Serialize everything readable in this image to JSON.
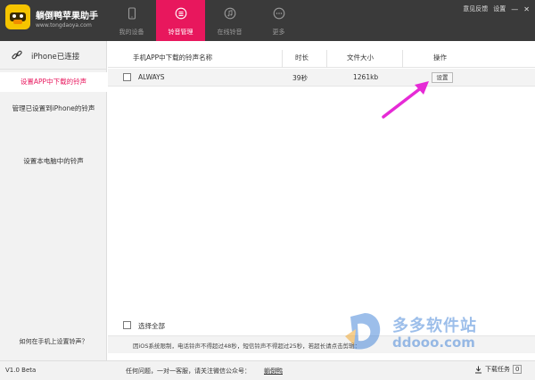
{
  "app": {
    "title": "躺倒鸭苹果助手",
    "url": "www.tongdaoya.com"
  },
  "top_links": {
    "feedback": "意见反馈",
    "settings": "设置"
  },
  "nav": {
    "tabs": [
      {
        "label": "我的设备",
        "icon": "phone-icon",
        "active": false
      },
      {
        "label": "铃音管理",
        "icon": "ringtone-icon",
        "active": true
      },
      {
        "label": "在线铃音",
        "icon": "music-note-icon",
        "active": false
      },
      {
        "label": "更多",
        "icon": "more-icon",
        "active": false
      }
    ]
  },
  "sidebar": {
    "connection": {
      "label": "iPhone已连接",
      "icon": "link-icon"
    },
    "items": [
      {
        "label": "设置APP中下载的铃声",
        "active": true
      },
      {
        "label": "管理已设置到iPhone的铃声",
        "active": false
      },
      {
        "label": "设置本电脑中的铃声",
        "active": false
      }
    ],
    "help": "如何在手机上设置铃声？"
  },
  "table": {
    "headers": [
      "手机APP中下载的铃声名称",
      "时长",
      "文件大小",
      "操作"
    ],
    "rows": [
      {
        "name": "ALWAYS",
        "duration": "39秒",
        "size": "1261kb",
        "action": "设置"
      }
    ],
    "select_all": "选择全部",
    "note": "因iOS系统限制，电话铃声不得超过48秒，短信铃声不得超过25秒，若超长请点击剪辑："
  },
  "status": {
    "version": "V1.0 Beta",
    "message": "任何问题，一对一客服，请关注微信公众号：",
    "link": "躺倒鸭",
    "download": "下载任务",
    "download_count": "0"
  },
  "watermark": {
    "line1": "多多软件站",
    "line2": "ddooo.com"
  },
  "colors": {
    "accent": "#e8175d",
    "header_bg": "#3a3a3a",
    "arrow": "#e62ad6"
  }
}
